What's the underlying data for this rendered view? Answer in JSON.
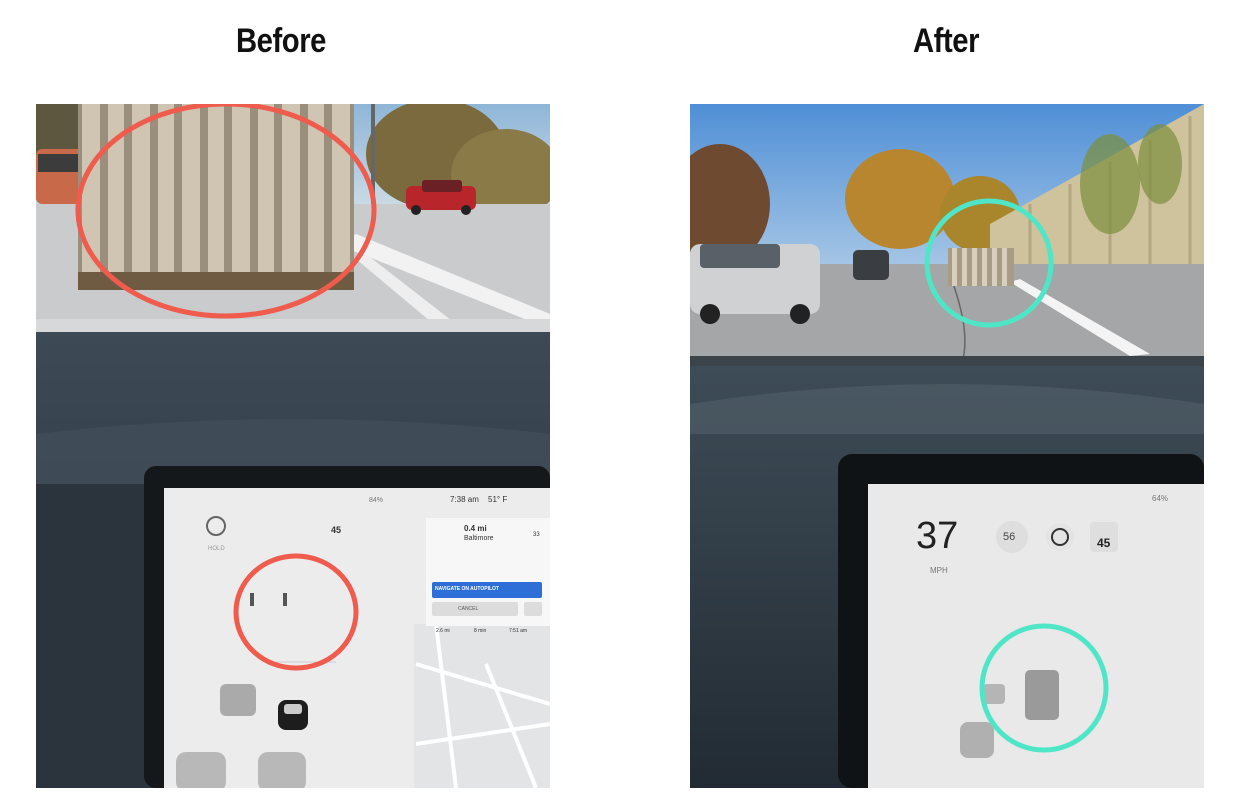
{
  "headings": {
    "before": "Before",
    "after": "After"
  },
  "before": {
    "status": {
      "battery": "84%",
      "time": "7:38 am",
      "temp": "51° F"
    },
    "speed_limit": "45",
    "gear_label": "HOLD",
    "nav": {
      "distance": "0.4 mi",
      "street": "Baltimore",
      "shield": "33",
      "button": "NAVIGATE ON AUTOPILOT",
      "cancel": "CANCEL",
      "trip": [
        "2.6 mi",
        "8 min",
        "7:51 am"
      ]
    },
    "highlight_color": "#ef5b4c"
  },
  "after": {
    "speed": "37",
    "speed_unit": "MPH",
    "set_speed": "56",
    "speed_limit": "45",
    "battery": "64%",
    "highlight_color": "#4fe6c8"
  }
}
